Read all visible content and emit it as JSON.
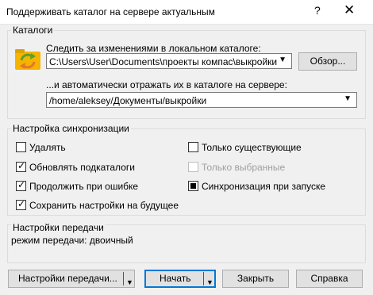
{
  "window": {
    "title": "Поддерживать каталог на сервере актуальным",
    "help_glyph": "?",
    "close_glyph": "✕"
  },
  "catalogs": {
    "group_label": "Каталоги",
    "local_label": "Следить за изменениями в локальном каталоге:",
    "local_path": "C:\\Users\\User\\Documents\\проекты компас\\выкройки",
    "browse_label": "Обзор...",
    "server_label": "...и автоматически отражать их в каталоге на сервере:",
    "server_path": "/home/aleksey/Документы/выкройки"
  },
  "sync": {
    "group_label": "Настройка синхронизации",
    "options": {
      "delete": {
        "label": "Удалять",
        "checked": false
      },
      "update_subfolders": {
        "label": "Обновлять подкаталоги",
        "checked": true
      },
      "continue_on_error": {
        "label": "Продолжить при ошибке",
        "checked": true
      },
      "save_settings": {
        "label": "Сохранить настройки на будущее",
        "checked": true
      },
      "only_existing": {
        "label": "Только существующие",
        "checked": false
      },
      "only_selected": {
        "label": "Только выбранные",
        "checked": false,
        "disabled": true
      },
      "sync_on_start": {
        "label": "Синхронизация при запуске",
        "checked": "indeterminate"
      }
    }
  },
  "transfer": {
    "group_label": "Настройки передачи",
    "mode_text": "режим передачи: двоичный"
  },
  "buttons": {
    "transfer_settings": "Настройки передачи...",
    "start": "Начать",
    "close": "Закрыть",
    "help": "Справка"
  },
  "icons": {
    "folder_sync": "folder-sync-icon",
    "dropdown": "▼",
    "check": "✓"
  },
  "colors": {
    "accent": "#0078d7",
    "folder": "#f4b400",
    "sync_green": "#5aa02c",
    "sync_orange": "#e8742a"
  }
}
